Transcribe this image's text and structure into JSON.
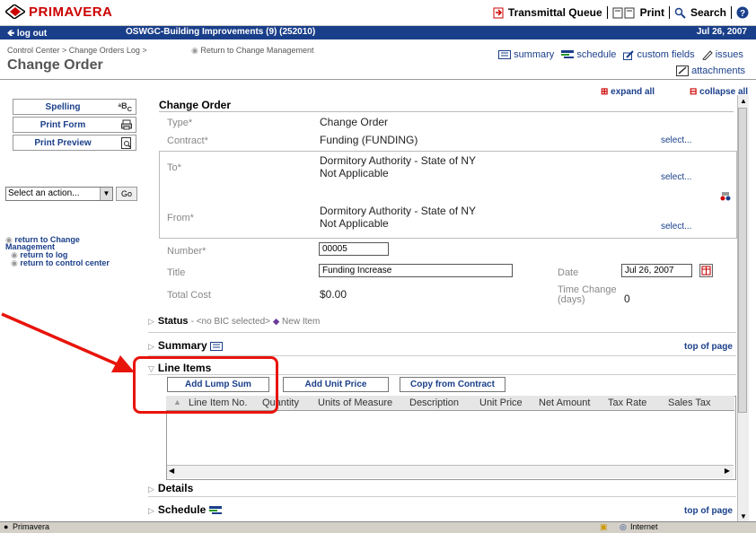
{
  "header": {
    "brand": "PRIMAVERA",
    "transmittal_queue": "Transmittal Queue",
    "print": "Print",
    "search": "Search",
    "help_icon": "question-icon"
  },
  "bluebar": {
    "logout": "log out",
    "project": "OSWGC-Building Improvements (9) (252010)",
    "date": "Jul 26, 2007"
  },
  "breadcrumb": {
    "path": "Control Center > Change Orders Log >",
    "return_link": "Return to Change Management"
  },
  "page_title": "Change Order",
  "tabs": {
    "summary": "summary",
    "schedule": "schedule",
    "custom_fields": "custom fields",
    "issues": "issues",
    "attachments": "attachments"
  },
  "left_panel": {
    "spelling": "Spelling",
    "print_form": "Print Form",
    "print_preview": "Print Preview",
    "action_select": "Select an action...",
    "go": "Go",
    "links": {
      "return_change_1": "return to Change",
      "return_change_2": "Management",
      "return_log": "return to log",
      "return_cc": "return to control center"
    }
  },
  "controls": {
    "expand_all": "expand all",
    "collapse_all": "collapse all"
  },
  "form": {
    "section_title": "Change Order",
    "type_label": "Type*",
    "type_value": "Change Order",
    "contract_label": "Contract*",
    "contract_value": "Funding (FUNDING)",
    "to_label": "To*",
    "to_value_1": "Dormitory Authority - State of NY",
    "to_value_2": "Not Applicable",
    "from_label": "From*",
    "from_value_1": "Dormitory Authority - State of NY",
    "from_value_2": "Not Applicable",
    "select": "select...",
    "number_label": "Number*",
    "number_value": "00005",
    "title_label": "Title",
    "title_value": "Funding Increase",
    "date_label": "Date",
    "date_value": "Jul 26, 2007",
    "total_cost_label": "Total Cost",
    "total_cost_value": "$0.00",
    "time_change_label_1": "Time Change",
    "time_change_label_2": "(days)",
    "time_change_value": "0"
  },
  "sections": {
    "status": "Status",
    "status_detail": "- <no BIC selected>",
    "status_new": "New Item",
    "summary": "Summary",
    "top_of_page": "top of page",
    "line_items": "Line Items",
    "details": "Details",
    "schedule": "Schedule"
  },
  "line_items": {
    "add_lump_sum": "Add Lump Sum",
    "add_unit_price": "Add Unit Price",
    "copy_from_contract": "Copy from Contract",
    "columns": [
      "Line Item No.",
      "Quantity",
      "Units of Measure",
      "Description",
      "Unit Price",
      "Net Amount",
      "Tax Rate",
      "Sales Tax"
    ]
  },
  "statusbar": {
    "app": "Primavera",
    "zone": "Internet"
  },
  "colors": {
    "brand_red": "#cc0000",
    "nav_blue": "#1a3f8a",
    "annotation_red": "#e8140c"
  }
}
